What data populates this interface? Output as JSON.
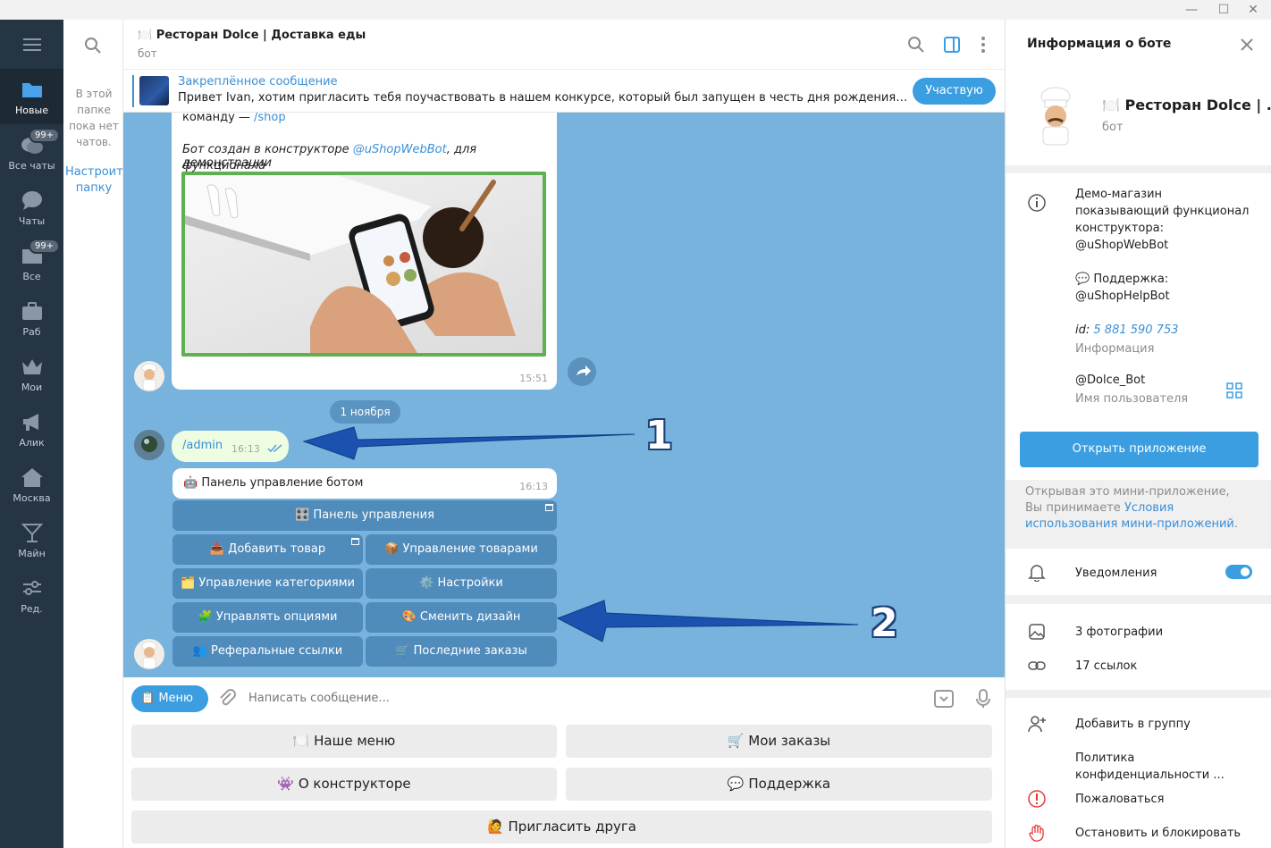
{
  "rail": {
    "folders": [
      {
        "label": "Новые",
        "icon": "folder-icon",
        "badge": ""
      },
      {
        "label": "Все чаты",
        "icon": "chats-icon",
        "badge": "99+"
      },
      {
        "label": "Чаты",
        "icon": "chat-bubble-icon",
        "badge": ""
      },
      {
        "label": "Все",
        "icon": "folder-icon",
        "badge": "99+"
      },
      {
        "label": "Раб",
        "icon": "briefcase-icon",
        "badge": ""
      },
      {
        "label": "Мои",
        "icon": "crown-icon",
        "badge": ""
      },
      {
        "label": "Алик",
        "icon": "megaphone-icon",
        "badge": ""
      },
      {
        "label": "Москва",
        "icon": "house-icon",
        "badge": ""
      },
      {
        "label": "Майн",
        "icon": "cocktail-icon",
        "badge": ""
      },
      {
        "label": "Ред.",
        "icon": "sliders-icon",
        "badge": ""
      }
    ]
  },
  "chatlist": {
    "empty_text": "В этой папке пока нет чатов.",
    "setup_link": "Настроить папку"
  },
  "header": {
    "title": "🍽️ Ресторан Dolce | Доставка еды",
    "subtitle": "бот"
  },
  "pinned": {
    "title": "Закреплённое сообщение",
    "text": "Привет Ivan, хотим пригласить тебя поучаствовать в нашем конкурсе, который был запущен в честь дня рождения конструктора",
    "button": "Участвую"
  },
  "messages": {
    "m1_line1_prefix": "команду — ",
    "m1_line1_link": "/shop",
    "m1_line2_prefix": "Бот создан в конструкторе ",
    "m1_line2_link": "@uShopWebBot",
    "m1_line2_suffix": ", для демонстрации",
    "m1_line3": "функционала",
    "m1_time": "15:51",
    "date": "1 ноября",
    "out_text": "/admin",
    "out_time": "16:13",
    "bot_text": "🤖 Панель управление ботом",
    "bot_time": "16:13"
  },
  "inline_keyboard": [
    "🎛️ Панель управления",
    "📥 Добавить товар",
    "📦 Управление товарами",
    "🗂️ Управление категориями",
    "⚙️ Настройки",
    "🧩 Управлять опциями",
    "🎨 Сменить дизайн",
    "👥 Реферальные ссылки",
    "🛒 Последние заказы"
  ],
  "annotations": [
    "1",
    "2"
  ],
  "composer": {
    "menu": "📋 Меню",
    "placeholder": "Написать сообщение..."
  },
  "reply_keyboard": [
    "🍽️ Наше меню",
    "🛒 Мои заказы",
    "👾 О конструкторе",
    "💬 Поддержка",
    "🙋 Пригласить друга"
  ],
  "panel": {
    "title": "Информация о боте",
    "bot_name": "🍽️ Ресторан Dolce | ...",
    "bot_sub": "бот",
    "desc_line1": "Демо-магазин",
    "desc_line2": "показывающий функционал",
    "desc_line3": "конструктора:",
    "desc_link": "@uShopWebBot",
    "support_label": "💬 Поддержка:",
    "support_link": "@uShopHelpBot",
    "id_label": "id:",
    "id_value": "5 881 590 753",
    "info_label": "Информация",
    "username": "@Dolce_Bot",
    "username_label": "Имя пользователя",
    "open_app": "Открыть приложение",
    "note_prefix": "Открывая это мини-приложение, Вы принимаете ",
    "note_link": "Условия использования мини-приложений",
    "note_suffix": ".",
    "notifications": "Уведомления",
    "photos": "3 фотографии",
    "links": "17 ссылок",
    "add_group": "Добавить в группу",
    "privacy": "Политика конфиденциальности ...",
    "report": "Пожаловаться",
    "block": "Остановить и блокировать"
  },
  "colors": {
    "accent": "#3a9ee0",
    "chat_bg": "#77b3dc",
    "inline_btn": "#4f8bbb",
    "rail_bg": "#253544",
    "danger": "#e53935"
  }
}
